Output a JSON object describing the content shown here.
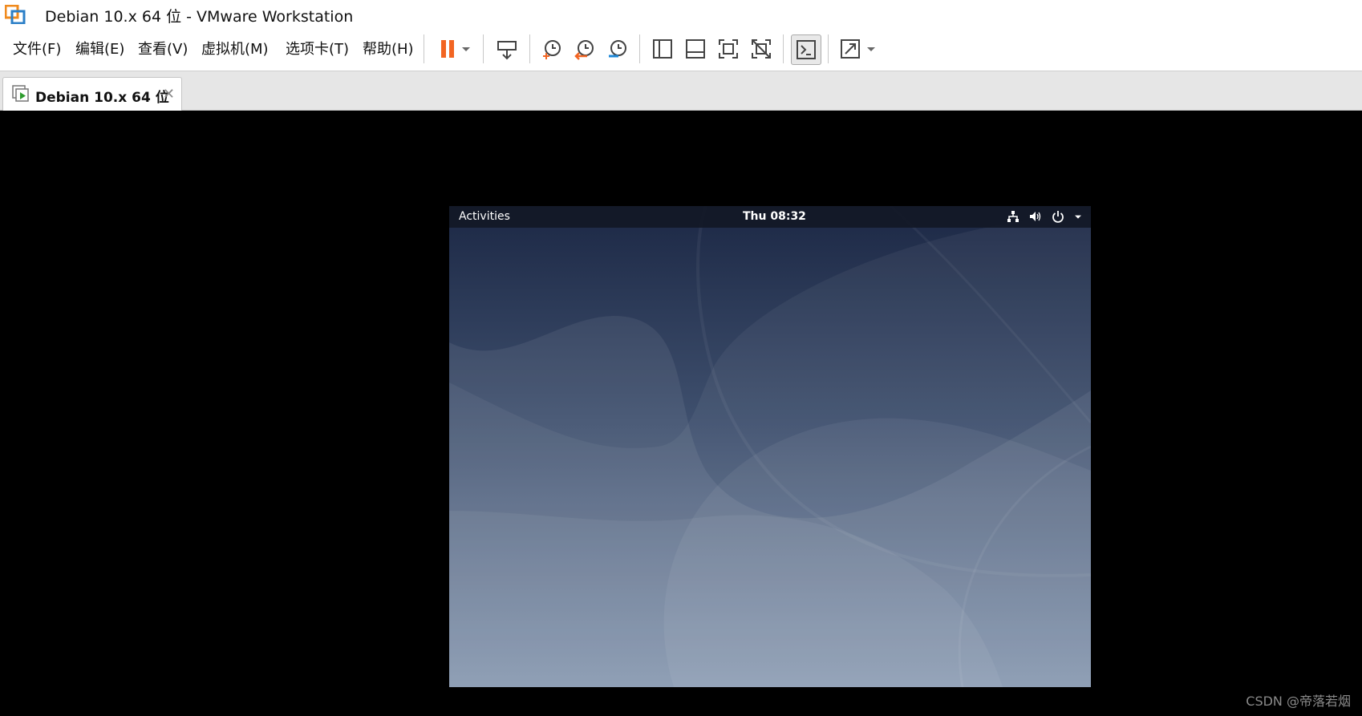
{
  "window": {
    "title": "Debian 10.x 64 位 - VMware Workstation"
  },
  "menu": {
    "items": [
      {
        "label": "文件(F)"
      },
      {
        "label": "编辑(E)"
      },
      {
        "label": "查看(V)"
      },
      {
        "label": "虚拟机(M)"
      },
      {
        "label": "选项卡(T)"
      },
      {
        "label": "帮助(H)"
      }
    ]
  },
  "toolbar": {
    "icons": [
      "pause-icon",
      "send-ctrl-alt-del-icon",
      "snapshot-take-icon",
      "snapshot-revert-icon",
      "snapshot-manager-icon",
      "library-view-icon",
      "thumbnail-bar-icon",
      "full-screen-icon",
      "unity-icon",
      "console-view-icon",
      "stretch-guest-icon"
    ],
    "accent_pause": "#f26522"
  },
  "tab": {
    "label": "Debian 10.x 64 位",
    "close": "✕"
  },
  "guest": {
    "activities": "Activities",
    "clock": "Thu 08:32",
    "tray_icons": [
      "network-icon",
      "volume-icon",
      "power-icon",
      "dropdown-arrow-icon"
    ]
  },
  "watermark": "CSDN @帝落若烟"
}
